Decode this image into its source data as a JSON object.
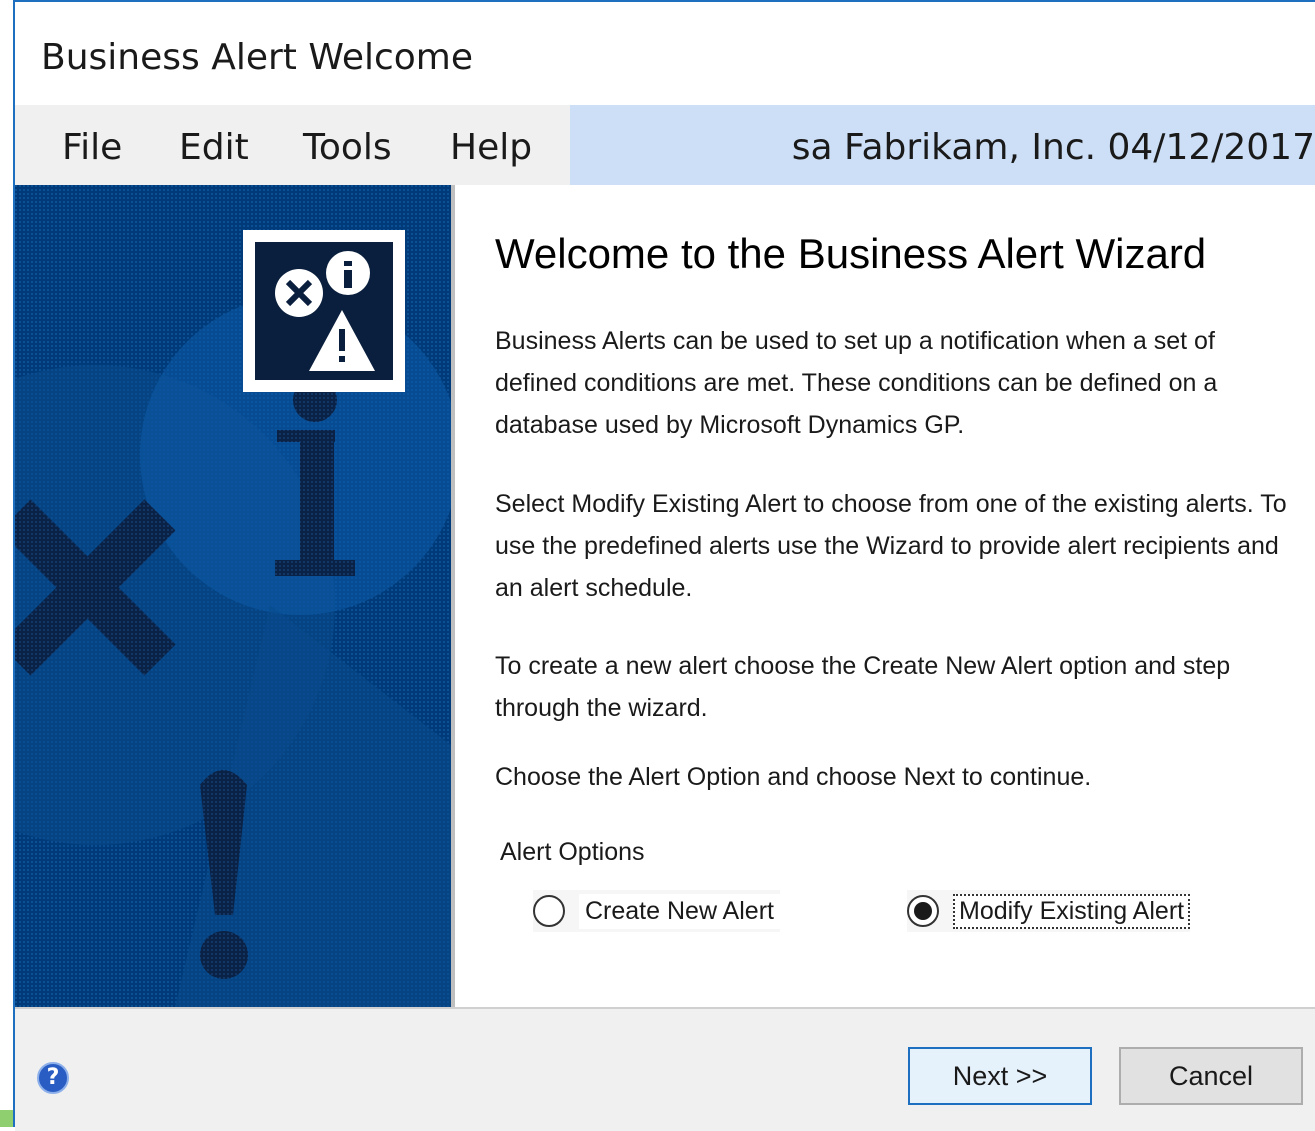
{
  "window": {
    "title": "Business Alert Welcome"
  },
  "menu": {
    "items": [
      {
        "label": "File"
      },
      {
        "label": "Edit"
      },
      {
        "label": "Tools"
      },
      {
        "label": "Help"
      }
    ]
  },
  "infobar": {
    "text": "sa  Fabrikam, Inc.  04/12/2017"
  },
  "content": {
    "heading": "Welcome to the Business Alert Wizard",
    "paragraphs": [
      "Business Alerts can be used to set up a notification when a set of defined conditions are met. These conditions can be defined on a database used by Microsoft Dynamics GP.",
      "Select Modify Existing Alert to choose from one of the existing alerts. To use the predefined alerts use the Wizard to provide alert recipients and an alert schedule.",
      "To create a new alert choose the Create New Alert option and step through the wizard.",
      "Choose the Alert Option and choose Next to continue."
    ],
    "options_label": "Alert Options",
    "options": [
      {
        "label": "Create New Alert",
        "selected": false
      },
      {
        "label": "Modify Existing Alert",
        "selected": true
      }
    ]
  },
  "footer": {
    "help_icon": "help-icon",
    "help_glyph": "?",
    "next_label": "Next >>",
    "cancel_label": "Cancel"
  },
  "colors": {
    "accent": "#1e6fbf",
    "side_panel": "#003a78",
    "infobar": "#cddff6"
  }
}
